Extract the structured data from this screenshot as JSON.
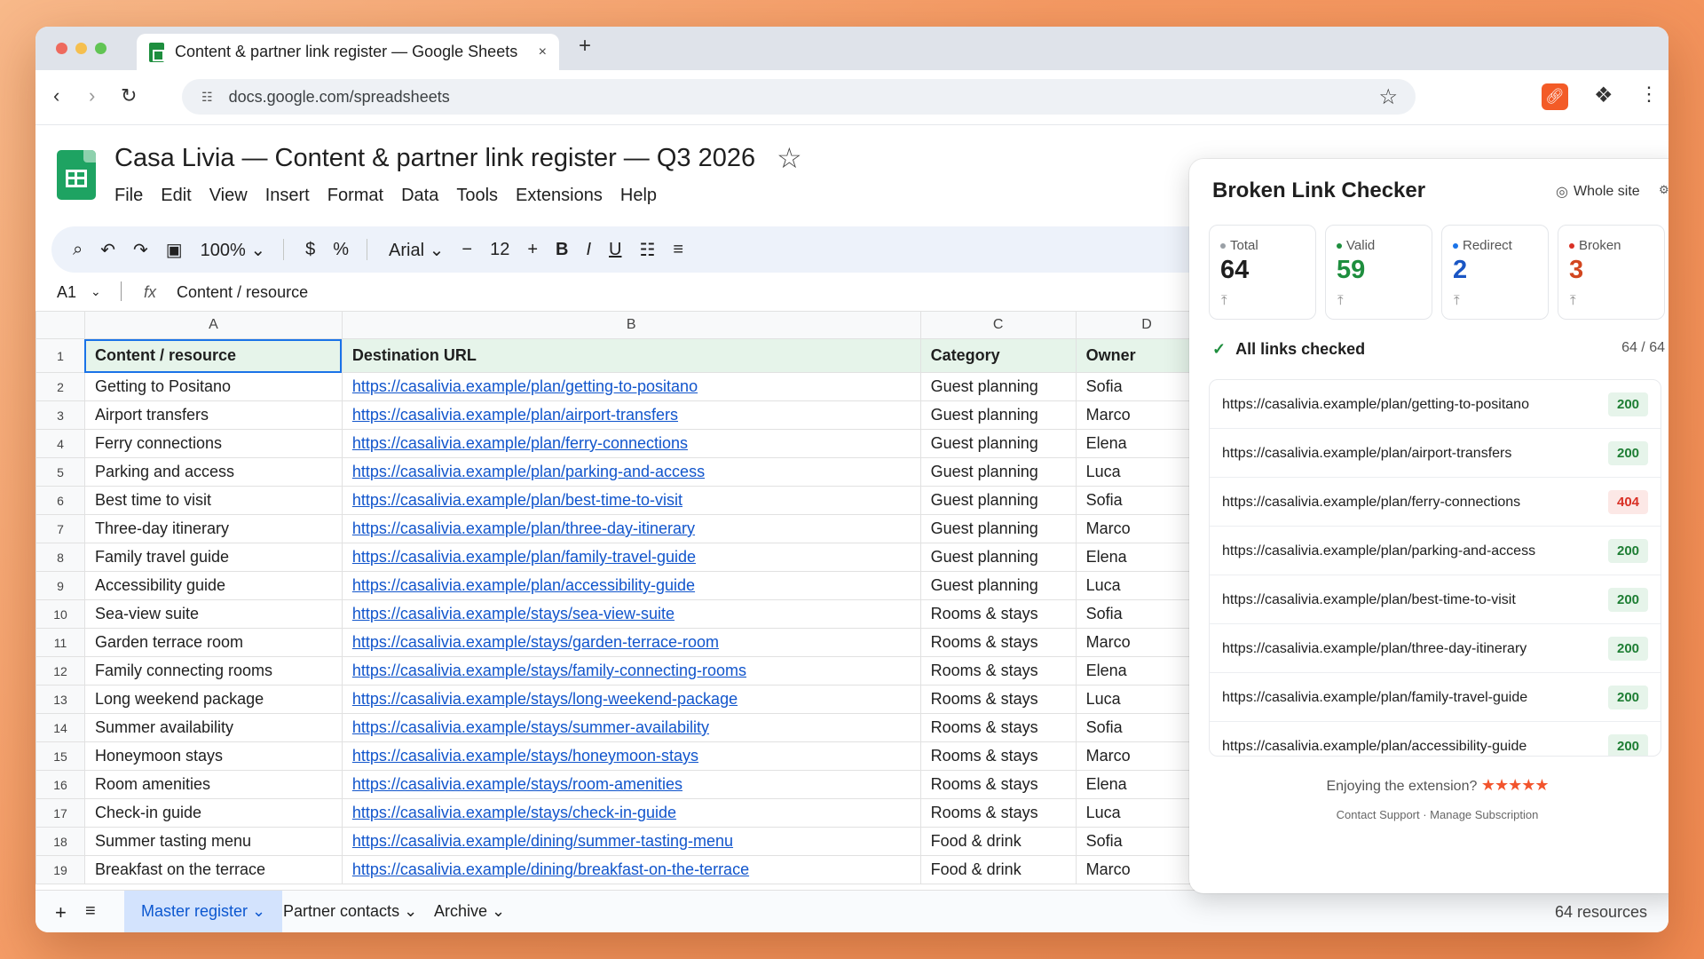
{
  "browser": {
    "tab_title": "Content & partner link register — Google Sheets",
    "tab_close": "×",
    "new_tab": "+",
    "url": "docs.google.com/spreadsheets"
  },
  "doc": {
    "title": "Casa Livia — Content & partner link register — Q3 2026",
    "menu": [
      "File",
      "Edit",
      "View",
      "Insert",
      "Format",
      "Data",
      "Tools",
      "Extensions",
      "Help"
    ]
  },
  "toolbar": {
    "zoom": "100%",
    "currency": "$",
    "percent": "%",
    "font": "Arial",
    "font_size": "12",
    "minus": "−",
    "plus": "+",
    "bold": "B",
    "italic": "I",
    "underline": "U"
  },
  "formula_bar": {
    "cell_ref": "A1",
    "fx": "fx",
    "value": "Content / resource"
  },
  "sheet": {
    "column_letters": [
      "A",
      "B",
      "C",
      "D"
    ],
    "headers": [
      "Content / resource",
      "Destination URL",
      "Category",
      "Owner"
    ],
    "rows": [
      [
        "2",
        "Getting to Positano",
        "https://casalivia.example/plan/getting-to-positano",
        "Guest planning",
        "Sofia"
      ],
      [
        "3",
        "Airport transfers",
        "https://casalivia.example/plan/airport-transfers",
        "Guest planning",
        "Marco"
      ],
      [
        "4",
        "Ferry connections",
        "https://casalivia.example/plan/ferry-connections",
        "Guest planning",
        "Elena"
      ],
      [
        "5",
        "Parking and access",
        "https://casalivia.example/plan/parking-and-access",
        "Guest planning",
        "Luca"
      ],
      [
        "6",
        "Best time to visit",
        "https://casalivia.example/plan/best-time-to-visit",
        "Guest planning",
        "Sofia"
      ],
      [
        "7",
        "Three-day itinerary",
        "https://casalivia.example/plan/three-day-itinerary",
        "Guest planning",
        "Marco"
      ],
      [
        "8",
        "Family travel guide",
        "https://casalivia.example/plan/family-travel-guide",
        "Guest planning",
        "Elena"
      ],
      [
        "9",
        "Accessibility guide",
        "https://casalivia.example/plan/accessibility-guide",
        "Guest planning",
        "Luca"
      ],
      [
        "10",
        "Sea-view suite",
        "https://casalivia.example/stays/sea-view-suite",
        "Rooms & stays",
        "Sofia"
      ],
      [
        "11",
        "Garden terrace room",
        "https://casalivia.example/stays/garden-terrace-room",
        "Rooms & stays",
        "Marco"
      ],
      [
        "12",
        "Family connecting rooms",
        "https://casalivia.example/stays/family-connecting-rooms",
        "Rooms & stays",
        "Elena"
      ],
      [
        "13",
        "Long weekend package",
        "https://casalivia.example/stays/long-weekend-package",
        "Rooms & stays",
        "Luca"
      ],
      [
        "14",
        "Summer availability",
        "https://casalivia.example/stays/summer-availability",
        "Rooms & stays",
        "Sofia"
      ],
      [
        "15",
        "Honeymoon stays",
        "https://casalivia.example/stays/honeymoon-stays",
        "Rooms & stays",
        "Marco"
      ],
      [
        "16",
        "Room amenities",
        "https://casalivia.example/stays/room-amenities",
        "Rooms & stays",
        "Elena"
      ],
      [
        "17",
        "Check-in guide",
        "https://casalivia.example/stays/check-in-guide",
        "Rooms & stays",
        "Luca"
      ],
      [
        "18",
        "Summer tasting menu",
        "https://casalivia.example/dining/summer-tasting-menu",
        "Food & drink",
        "Sofia"
      ],
      [
        "19",
        "Breakfast on the terrace",
        "https://casalivia.example/dining/breakfast-on-the-terrace",
        "Food & drink",
        "Marco"
      ]
    ]
  },
  "sheet_tabs": {
    "tabs": [
      "Master register",
      "Partner contacts",
      "Archive"
    ],
    "count": "64 resources"
  },
  "popup": {
    "title": "Broken Link Checker",
    "scope": "Whole site",
    "stats": [
      {
        "label": "Total",
        "value": "64",
        "color": "#1f1f1f",
        "dot": "#9aa0a6"
      },
      {
        "label": "Valid",
        "value": "59",
        "color": "#1e8e3e",
        "dot": "#1e8e3e"
      },
      {
        "label": "Redirect",
        "value": "2",
        "color": "#1a56c4",
        "dot": "#1a73e8"
      },
      {
        "label": "Broken",
        "value": "3",
        "color": "#d2461f",
        "dot": "#d93025"
      }
    ],
    "status_label": "All links checked",
    "status_count": "64 / 64",
    "links": [
      {
        "url": "https://casalivia.example/plan/getting-to-positano",
        "code": "200"
      },
      {
        "url": "https://casalivia.example/plan/airport-transfers",
        "code": "200"
      },
      {
        "url": "https://casalivia.example/plan/ferry-connections",
        "code": "404"
      },
      {
        "url": "https://casalivia.example/plan/parking-and-access",
        "code": "200"
      },
      {
        "url": "https://casalivia.example/plan/best-time-to-visit",
        "code": "200"
      },
      {
        "url": "https://casalivia.example/plan/three-day-itinerary",
        "code": "200"
      },
      {
        "url": "https://casalivia.example/plan/family-travel-guide",
        "code": "200"
      },
      {
        "url": "https://casalivia.example/plan/accessibility-guide",
        "code": "200"
      }
    ],
    "enjoy_text": "Enjoying the extension?",
    "rating_stars": "★★★★★",
    "footer_links": "Contact Support · Manage Subscription"
  }
}
